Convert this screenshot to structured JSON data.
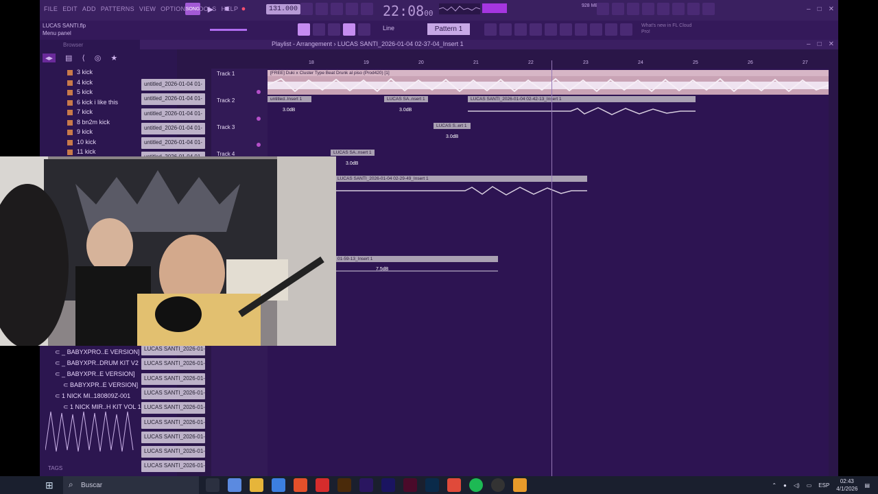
{
  "menu": {
    "items": [
      "FILE",
      "EDIT",
      "ADD",
      "PATTERNS",
      "VIEW",
      "OPTIONS",
      "TOOLS",
      "HELP"
    ],
    "project_name": "LUCAS SANTI.flp",
    "panel_label": "Menu panel"
  },
  "transport": {
    "tempo": "131.000",
    "time": "22:08",
    "time_small": "00",
    "cpu_memory": "928 MB",
    "snap_mode": "Line",
    "pattern": "Pattern 1",
    "whats_new": "What's new in FL Cloud Pro!"
  },
  "browser": {
    "title": "Browser",
    "kick_items": [
      "3 kick",
      "4 kick",
      "5 kick",
      "6 kick i like this",
      "7 kick",
      "8 bn2m kick",
      "9 kick",
      "10 kick",
      "11 kick"
    ],
    "folders": [
      "BABYXPRO..E VERSION]",
      "BABYXPR..DRUM KIT V2",
      "BABYXPR..E VERSION]",
      "BABYXPR..E VERSION]",
      "1 NICK MI..180809Z-001",
      "1 NICK MIR..H KIT VOL 1"
    ],
    "tags": "TAGS"
  },
  "channels": {
    "top": [
      "untitled_2026-01-04 01-",
      "untitled_2026-01-04 01-",
      "untitled_2026-01-04 01-",
      "untitled_2026-01-04 01-",
      "untitled_2026-01-04 01-",
      "untitled_2026-01-04 01-"
    ],
    "bottom": [
      "LUCAS SANTI_2026-01-04...",
      "LUCAS SANTI_2026-01-04...",
      "LUCAS SANTI_2026-01-04...",
      "LUCAS SANTI_2026-01-04...",
      "LUCAS SANTI_2026-01-04...",
      "LUCAS SANTI_2026-01-04...",
      "LUCAS SANTI_2026-01-04...",
      "LUCAS SANTI_2026-01-04...",
      "LUCAS SANTI_2026-01-04..."
    ]
  },
  "playlist": {
    "title": "Playlist - Arrangement",
    "project": "LUCAS SANTI_2026-01-04 02-37-04_Insert 1",
    "bars": [
      "18",
      "19",
      "20",
      "21",
      "22",
      "23",
      "24",
      "25",
      "26",
      "27"
    ],
    "tracks": [
      "Track 1",
      "Track 2",
      "Track 3",
      "Track 4"
    ],
    "clips": {
      "beat": "[FREE] Duki x Cluster Type Beat  Drunk al piso (Prod420) [1]",
      "c1": "untitled..Insert 1",
      "c2": "LUCAS SA..nsert 1",
      "c3": "LUCAS SANTI_2026-01-04 02-42-13_Insert 1",
      "c4": "LUCAS S..ert 1",
      "c5": "LUCAS SA..nsert 1",
      "c6": "LUCAS SANTI_2026-01-04 02-29-49_Insert 1",
      "c7": "01-59-13_Insert 1"
    },
    "gains": [
      "3.0dB",
      "3.0dB",
      "3.0dB",
      "3.0dB",
      "7.5dB"
    ]
  },
  "taskbar": {
    "search_placeholder": "Buscar",
    "lang": "ESP",
    "time": "02:43",
    "date": "4/1/2026"
  }
}
